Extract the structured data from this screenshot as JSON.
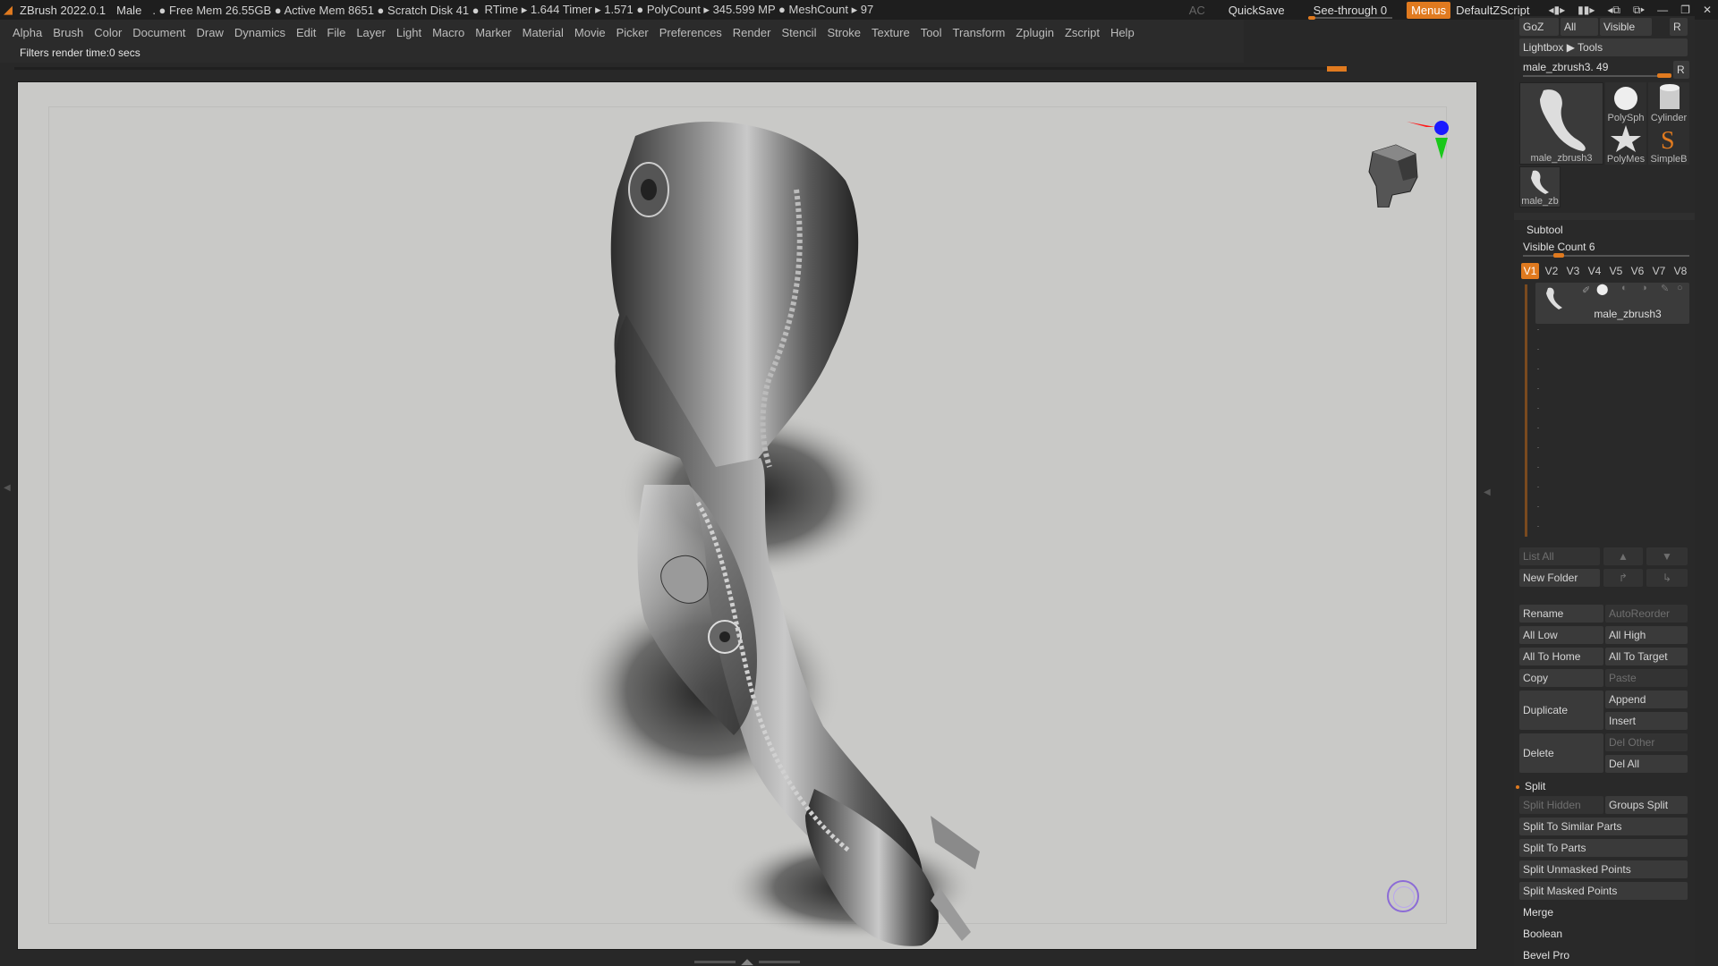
{
  "titlebar": {
    "app": "ZBrush 2022.0.1",
    "doc": "Male",
    "free_mem": ". ● Free Mem 26.55GB ● Active Mem 8651 ● Scratch Disk 41 ●",
    "rtime": "RTime ▸ 1.644 Timer ▸ 1.571 ● PolyCount ▸ 345.599 MP ● MeshCount ▸ 97",
    "ac": "AC",
    "quicksave": "QuickSave",
    "seethrough": "See-through  0",
    "seethrough_value": 0,
    "menus": "Menus",
    "default_zscript": "DefaultZScript"
  },
  "menubar": [
    "Alpha",
    "Brush",
    "Color",
    "Document",
    "Draw",
    "Dynamics",
    "Edit",
    "File",
    "Layer",
    "Light",
    "Macro",
    "Marker",
    "Material",
    "Movie",
    "Picker",
    "Preferences",
    "Render",
    "Stencil",
    "Stroke",
    "Texture",
    "Tool",
    "Transform",
    "Zplugin",
    "Zscript",
    "Help"
  ],
  "info": {
    "filters": "Filters render time:0 secs"
  },
  "rightpanel": {
    "top_row": [
      "GoZ",
      "All",
      "Visible",
      "R"
    ],
    "lightbox": "Lightbox ▶ Tools",
    "current_tool": "male_zbrush3. 49",
    "current_tool_r": "R",
    "tools": [
      {
        "name": "male_zbrush3"
      },
      {
        "name": "PolySph"
      },
      {
        "name": "Cylinder"
      },
      {
        "name": "PolyMes"
      },
      {
        "name": "SimpleB"
      },
      {
        "name": "male_zb"
      }
    ],
    "subtool_header": "Subtool",
    "visible_count": "Visible Count 6",
    "vtabs": [
      "V1",
      "V2",
      "V3",
      "V4",
      "V5",
      "V6",
      "V7",
      "V8"
    ],
    "subtool_item": "male_zbrush3",
    "list_all": "List All",
    "new_folder": "New Folder",
    "buttons": {
      "rename": "Rename",
      "autoreorder": "AutoReorder",
      "all_low": "All Low",
      "all_high": "All High",
      "all_to_home": "All To Home",
      "all_to_target": "All To Target",
      "copy": "Copy",
      "paste": "Paste",
      "duplicate": "Duplicate",
      "append": "Append",
      "insert": "Insert",
      "delete": "Delete",
      "del_other": "Del Other",
      "del_all": "Del All",
      "split": "Split",
      "split_hidden": "Split Hidden",
      "groups_split": "Groups Split",
      "split_similar": "Split To Similar Parts",
      "split_parts": "Split To Parts",
      "split_unmasked": "Split Unmasked Points",
      "split_masked": "Split Masked Points",
      "merge": "Merge",
      "boolean": "Boolean",
      "bevel_pro": "Bevel Pro"
    }
  },
  "colors": {
    "accent": "#e07a1f",
    "canvas": "#c9c9c7",
    "panel": "#2f2f2f"
  }
}
